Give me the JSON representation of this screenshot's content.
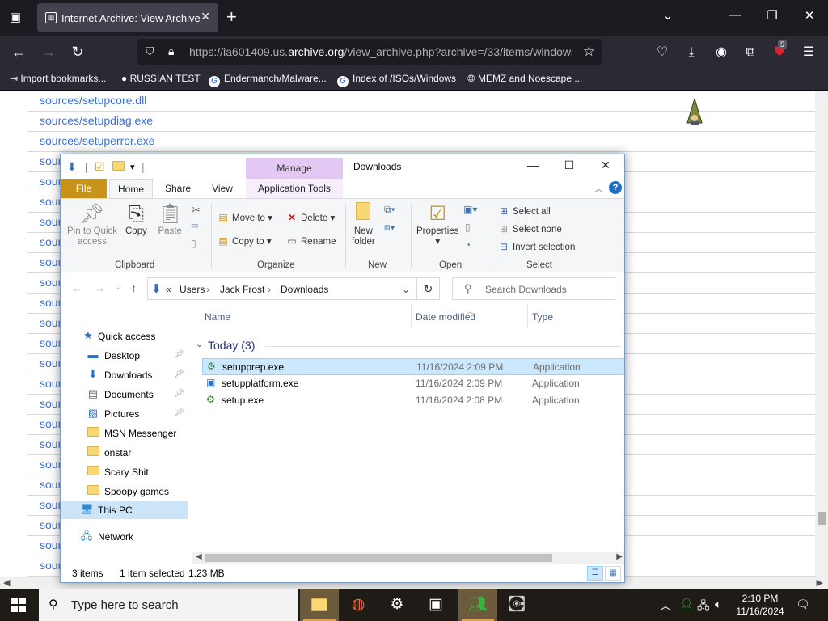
{
  "browser": {
    "tab_title": "Internet Archive: View Archive",
    "url_prefix": "https://ia601409.us.",
    "url_domain": "archive.org",
    "url_path": "/view_archive.php?archive=/33/items/windows",
    "extensions_badge": "5",
    "bookmarks": [
      "Import bookmarks...",
      "RUSSIAN TEST",
      "Endermanch/Malware...",
      "Index of /ISOs/Windows",
      "MEMZ and Noescape ..."
    ]
  },
  "page": {
    "links": [
      "sources/setupcore.dll",
      "sources/setupdiag.exe",
      "sources/setuperror.exe",
      "sour",
      "sour",
      "sour",
      "sour",
      "sour",
      "sour",
      "sour",
      "sour",
      "sour",
      "sour",
      "sour",
      "sour",
      "sour",
      "sour",
      "sour",
      "sour",
      "sour",
      "sour",
      "sour",
      "sour",
      "sour"
    ]
  },
  "explorer": {
    "manage_label": "Manage",
    "window_title": "Downloads",
    "tabs": {
      "file": "File",
      "home": "Home",
      "share": "Share",
      "view": "View",
      "app_tools": "Application Tools"
    },
    "ribbon": {
      "pin": "Pin to Quick",
      "pin2": "access",
      "copy": "Copy",
      "paste": "Paste",
      "move_to": "Move to",
      "copy_to": "Copy to",
      "delete": "Delete",
      "rename": "Rename",
      "new_folder": "New",
      "new_folder2": "folder",
      "properties": "Properties",
      "select_all": "Select all",
      "select_none": "Select none",
      "invert_selection": "Invert selection",
      "groups": {
        "clipboard": "Clipboard",
        "organize": "Organize",
        "new": "New",
        "open": "Open",
        "select": "Select"
      }
    },
    "breadcrumb": {
      "sep": "«",
      "users": "Users",
      "user": "Jack Frost",
      "folder": "Downloads"
    },
    "search_placeholder": "Search Downloads",
    "nav": {
      "quick_access": "Quick access",
      "items": [
        "Desktop",
        "Downloads",
        "Documents",
        "Pictures",
        "MSN Messenger",
        "onstar",
        "Scary Shit",
        "Spoopy games"
      ],
      "this_pc": "This PC",
      "network": "Network"
    },
    "columns": {
      "name": "Name",
      "date": "Date modified",
      "type": "Type"
    },
    "group_label": "Today (3)",
    "files": [
      {
        "name": "setupprep.exe",
        "date": "11/16/2024 2:09 PM",
        "type": "Application"
      },
      {
        "name": "setupplatform.exe",
        "date": "11/16/2024 2:09 PM",
        "type": "Application"
      },
      {
        "name": "setup.exe",
        "date": "11/16/2024 2:08 PM",
        "type": "Application"
      }
    ],
    "status": {
      "count": "3 items",
      "selected": "1 item selected",
      "size": "1.23 MB"
    }
  },
  "taskbar": {
    "search_placeholder": "Type here to search",
    "time": "2:10 PM",
    "date": "11/16/2024"
  }
}
